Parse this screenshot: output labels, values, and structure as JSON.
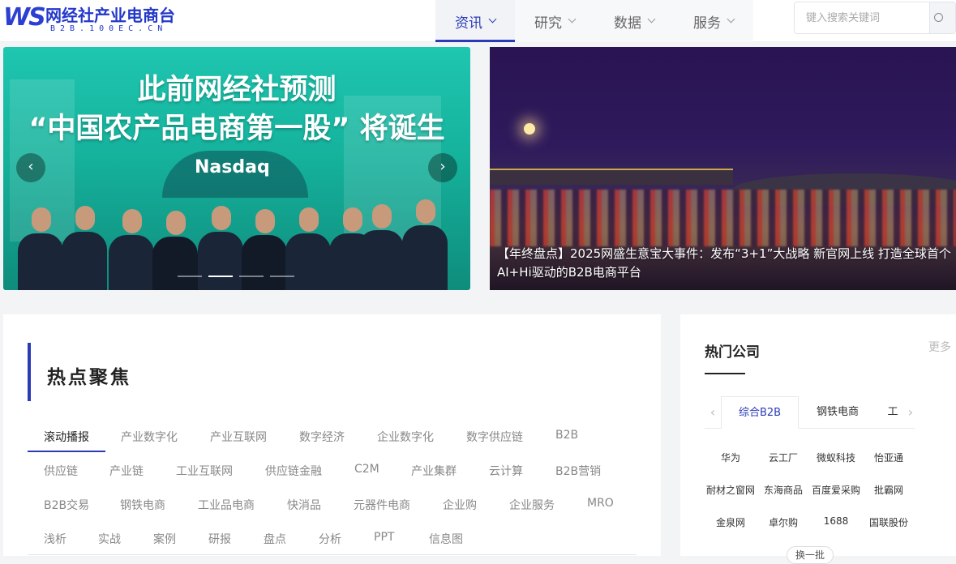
{
  "logo": {
    "mark": "WS",
    "title": "网经社产业电商台",
    "subtitle": "B2B.100EC.CN"
  },
  "nav": [
    {
      "label": "资讯"
    },
    {
      "label": "研究"
    },
    {
      "label": "数据"
    },
    {
      "label": "服务"
    }
  ],
  "search": {
    "placeholder": "键入搜索关键词"
  },
  "carousel": {
    "slide1": {
      "line1": "此前网经社预测",
      "line2": "“中国农产品电商第一股” 将诞生",
      "sign_text": "Nasdaq"
    },
    "slide2": {
      "caption_line1": "【年终盘点】2025网盛生意宝大事件：发布“3+1”大战略 新官网上线 打造全球首个",
      "caption_line2": "AI+Hi驱动的B2B电商平台"
    },
    "prev_arrow": "‹",
    "next_arrow": "›",
    "active_dot": 2
  },
  "hot_focus": {
    "title": "热点聚焦",
    "tags": [
      "滚动播报",
      "产业数字化",
      "产业互联网",
      "数字经济",
      "企业数字化",
      "数字供应链",
      "B2B",
      "供应链",
      "产业链",
      "工业互联网",
      "供应链金融",
      "C2M",
      "产业集群",
      "云计算",
      "B2B营销",
      "B2B交易",
      "钢铁电商",
      "工业品电商",
      "快消品",
      "元器件电商",
      "企业购",
      "企业服务",
      "MRO",
      "浅析",
      "实战",
      "案例",
      "研报",
      "盘点",
      "分析",
      "PPT",
      "信息图"
    ]
  },
  "hot_companies": {
    "title": "热门公司",
    "more": "更多",
    "tabs": [
      "综合B2B",
      "钢铁电商",
      "工"
    ],
    "prev_arrow": "‹",
    "next_arrow": "›",
    "companies": [
      "华为",
      "云工厂",
      "微蚁科技",
      "怡亚通",
      "耐材之窗网",
      "东海商品",
      "百度爱采购",
      "批霸网",
      "金泉网",
      "卓尔购",
      "1688",
      "国联股份"
    ],
    "swap_label": "换一批"
  },
  "colors": {
    "accent": "#2a3bb5",
    "banner1_bg": "#1fc6b0",
    "banner2_bg": "#2a1452"
  }
}
